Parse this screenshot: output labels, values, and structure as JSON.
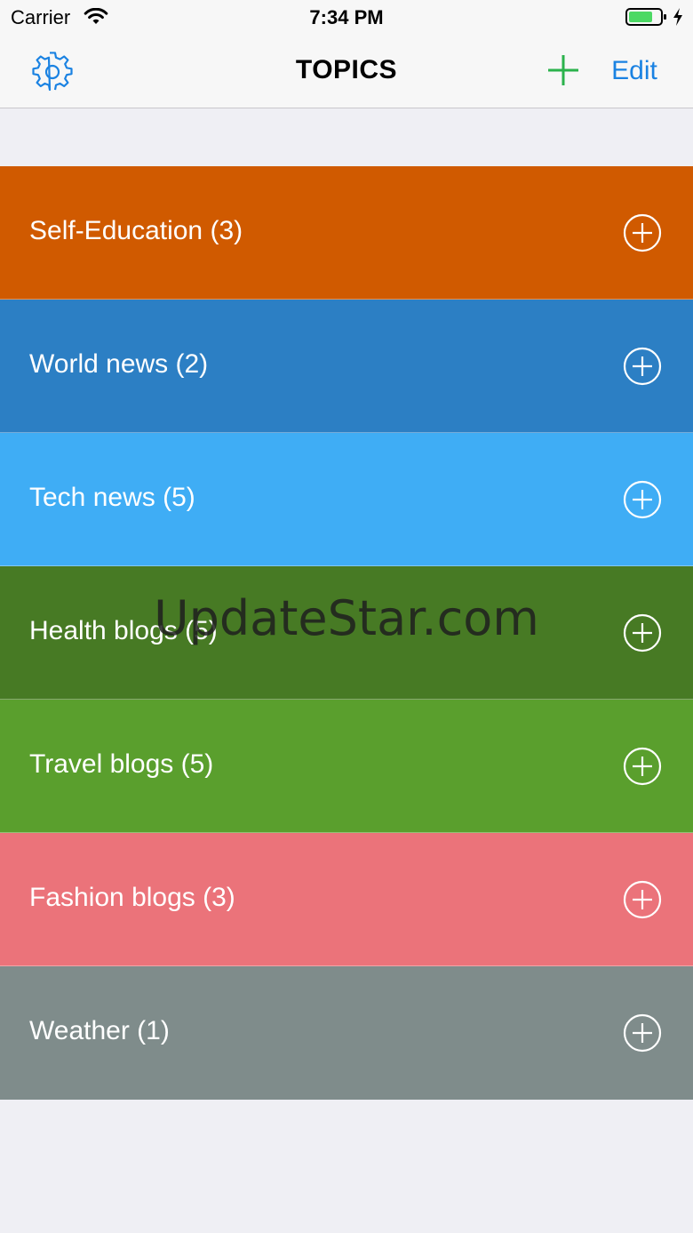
{
  "status_bar": {
    "carrier": "Carrier",
    "time": "7:34 PM",
    "battery_color": "#4cd964"
  },
  "nav": {
    "title": "TOPICS",
    "edit_label": "Edit",
    "accent_color": "#1a82e2",
    "add_color": "#2bb24c",
    "settings_icon": "gear-icon",
    "add_icon": "plus-icon"
  },
  "topics": [
    {
      "label": "Self-Education (3)",
      "color": "#d05a00"
    },
    {
      "label": "World news (2)",
      "color": "#2c7fc4"
    },
    {
      "label": "Tech news (5)",
      "color": "#3fadf5"
    },
    {
      "label": "Health blogs (5)",
      "color": "#477a24"
    },
    {
      "label": "Travel blogs (5)",
      "color": "#5a9f2d"
    },
    {
      "label": "Fashion blogs (3)",
      "color": "#eb737a"
    },
    {
      "label": "Weather (1)",
      "color": "#7f8c8b"
    }
  ],
  "watermark": "UpdateStar.com"
}
